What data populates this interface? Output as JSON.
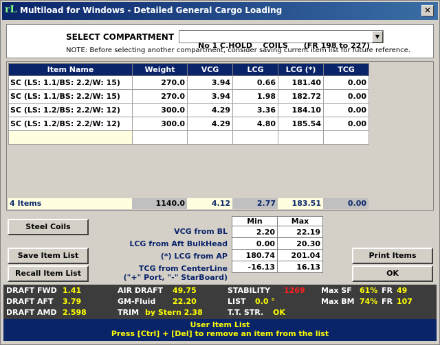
{
  "window": {
    "title": "Multiload for Windows - Detailed General Cargo Loading",
    "icon_text": "rL",
    "close": "✕"
  },
  "compartment": {
    "label": "SELECT COMPARTMENT",
    "selected": "No 1 C.HOLD    COILS      (FR 198 to 227)",
    "note": "NOTE: Before selecting another compartment, consider saving current item list for future reference."
  },
  "grid": {
    "headers": [
      "Item Name",
      "Weight",
      "VCG",
      "LCG",
      "LCG (*)",
      "TCG"
    ],
    "rows": [
      [
        "SC (LS: 1.1/BS: 2.2/W: 15)",
        "270.0",
        "3.94",
        "0.66",
        "181.40",
        "0.00"
      ],
      [
        "SC (LS: 1.1/BS: 2.2/W: 15)",
        "270.0",
        "3.94",
        "1.98",
        "182.72",
        "0.00"
      ],
      [
        "SC (LS: 1.2/BS: 2.2/W: 12)",
        "300.0",
        "4.29",
        "3.36",
        "184.10",
        "0.00"
      ],
      [
        "SC (LS: 1.2/BS: 2.2/W: 12)",
        "300.0",
        "4.29",
        "4.80",
        "185.54",
        "0.00"
      ]
    ],
    "totals": {
      "count": "4 Items",
      "weight": "1140.0",
      "vcg": "4.12",
      "lcg": "2.77",
      "lcg_star": "183.51",
      "tcg": "0.00"
    }
  },
  "buttons": {
    "steel_coils": "Steel Coils",
    "save": "Save Item List",
    "recall": "Recall Item List",
    "print": "Print Items",
    "ok": "OK"
  },
  "limits": {
    "min_header": "Min",
    "max_header": "Max",
    "rows": [
      {
        "label": "VCG from BL",
        "min": "2.20",
        "max": "22.19"
      },
      {
        "label": "LCG from Aft BulkHead",
        "min": "0.00",
        "max": "20.30"
      },
      {
        "label": "(*) LCG from AP",
        "min": "180.74",
        "max": "201.04"
      },
      {
        "label": "TCG from CenterLine",
        "sublabel": "(\"+\" Port, \"-\" StarBoard)",
        "min": "-16.13",
        "max": "16.13"
      }
    ]
  },
  "status": {
    "draft_fwd_label": "DRAFT FWD",
    "draft_fwd": "1.41",
    "draft_aft_label": "DRAFT AFT",
    "draft_aft": "3.79",
    "draft_amd_label": "DRAFT AMD",
    "draft_amd": "2.598",
    "air_draft_label": "AIR DRAFT",
    "air_draft": "49.75",
    "gm_label": "GM-Fluid",
    "gm": "22.20",
    "trim_label": "TRIM",
    "trim": "by Stern 2.38",
    "stability_label": "STABILITY",
    "stability": "1269",
    "list_label": "LIST",
    "list": "0.0 °",
    "tt_label": "T.T. STR.",
    "tt": "OK",
    "maxsf_label": "Max SF",
    "maxsf": "61%",
    "fr_label_1": "FR",
    "fr1": "49",
    "maxbm_label": "Max BM",
    "maxbm": "74%",
    "fr_label_2": "FR",
    "fr2": "107"
  },
  "footer": {
    "line1": "User Item List",
    "line2": "Press [Ctrl] + [Del] to remove an item from the list"
  }
}
